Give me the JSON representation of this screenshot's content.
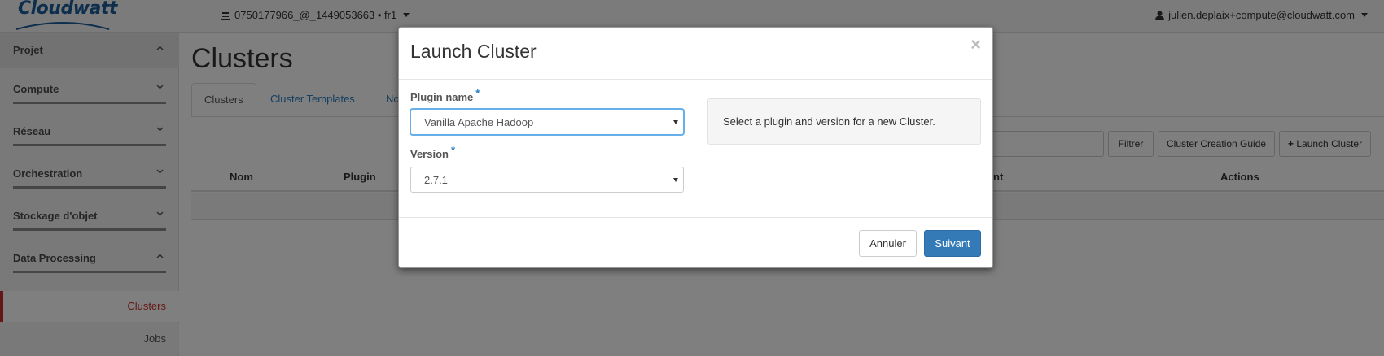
{
  "header": {
    "logo_text": "Cloudwatt",
    "project": "0750177966_@_1449053663 • fr1",
    "user": "julien.deplaix+compute@cloudwatt.com"
  },
  "sidebar": {
    "sections": [
      {
        "label": "Projet",
        "state": "expanded"
      },
      {
        "label": "Compute",
        "state": "collapsed"
      },
      {
        "label": "Réseau",
        "state": "collapsed"
      },
      {
        "label": "Orchestration",
        "state": "collapsed"
      },
      {
        "label": "Stockage d'objet",
        "state": "collapsed"
      },
      {
        "label": "Data Processing",
        "state": "expanded"
      }
    ],
    "items": [
      {
        "label": "Clusters",
        "active": true
      },
      {
        "label": "Jobs",
        "active": false
      }
    ]
  },
  "main": {
    "title": "Clusters",
    "tabs": [
      {
        "label": "Clusters",
        "active": true
      },
      {
        "label": "Cluster Templates",
        "active": false
      },
      {
        "label": "No",
        "active": false
      }
    ],
    "filter_button": "Filtrer",
    "guide_button": "Cluster Creation Guide",
    "launch_button": "Launch Cluster",
    "table_columns": [
      "Nom",
      "Plugin",
      "nt",
      "Actions"
    ]
  },
  "modal": {
    "title": "Launch Cluster",
    "close_glyph": "×",
    "plugin_label": "Plugin name",
    "plugin_value": "Vanilla Apache Hadoop",
    "version_label": "Version",
    "version_value": "2.7.1",
    "required_mark": "*",
    "help_text": "Select a plugin and version for a new Cluster.",
    "cancel_button": "Annuler",
    "next_button": "Suivant"
  },
  "colors": {
    "brand": "#1b5e9b",
    "link": "#2a7ec0",
    "primary": "#337ab7",
    "active_sidebar": "#c9302c"
  },
  "icons": [
    "server-icon",
    "user-icon",
    "chevron-up-icon",
    "chevron-down-icon",
    "plus-icon",
    "close-icon",
    "select-caret-icon"
  ]
}
